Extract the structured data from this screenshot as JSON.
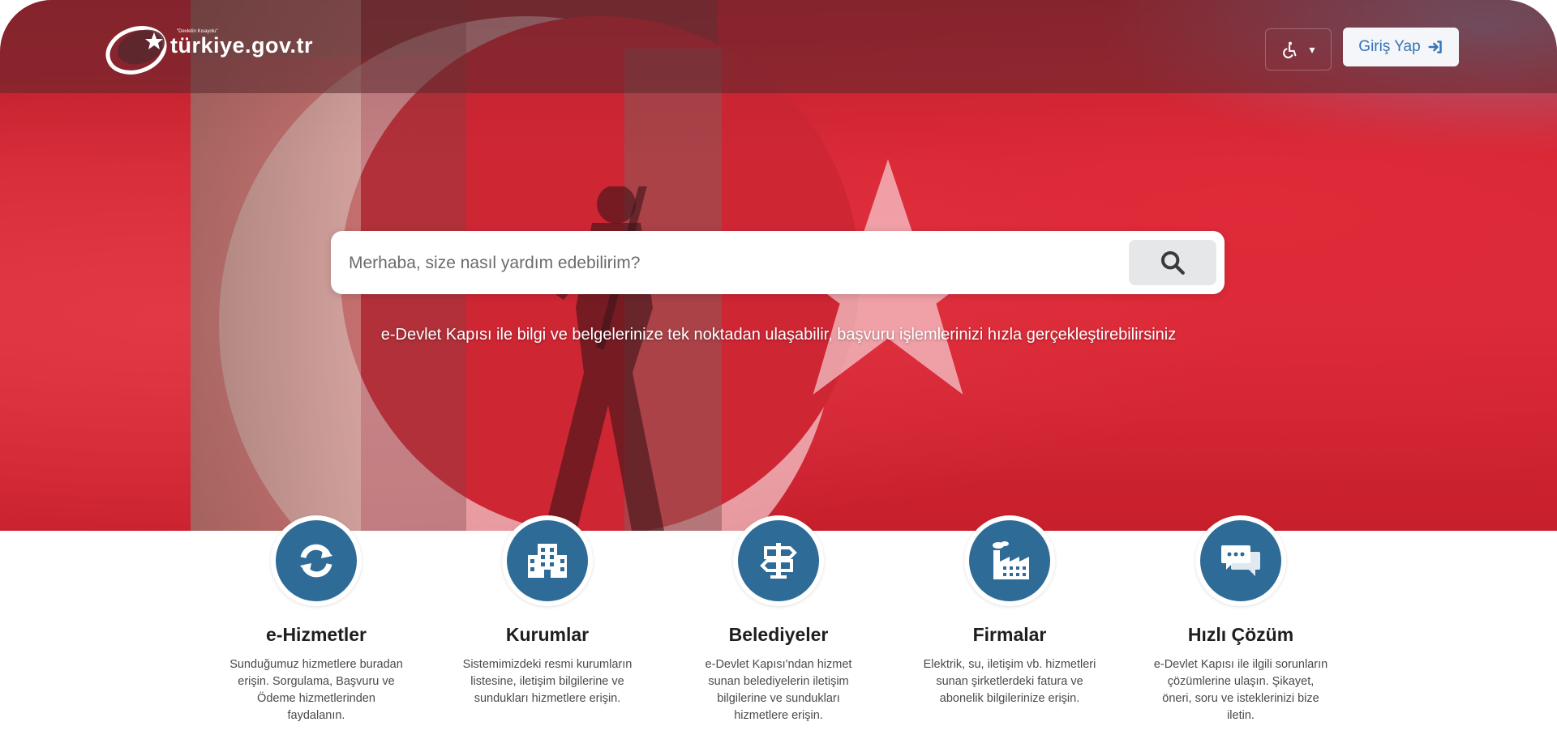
{
  "header": {
    "logo_text": "türkiye.gov.tr",
    "logo_sub": "\"Devletin Kısayolu\"",
    "accessibility_caret": "▾",
    "login_label": "Giriş Yap"
  },
  "search": {
    "placeholder": "Merhaba, size nasıl yardım edebilirim?"
  },
  "tagline": "e-Devlet Kapısı ile bilgi ve belgelerinize tek noktadan ulaşabilir, başvuru işlemlerinizi hızla gerçekleştirebilirsiniz",
  "cards": [
    {
      "title": "e-Hizmetler",
      "desc": "Sunduğumuz hizmetlere buradan erişin. Sorgulama, Başvuru ve Ödeme hizmetlerinden faydalanın.",
      "icon": "refresh-icon"
    },
    {
      "title": "Kurumlar",
      "desc": "Sistemimizdeki resmi kurumların listesine, iletişim bilgilerine ve sundukları hizmetlere erişin.",
      "icon": "building-icon"
    },
    {
      "title": "Belediyeler",
      "desc": "e-Devlet Kapısı'ndan hizmet sunan belediyelerin iletişim bilgilerine ve sundukları hizmetlere erişin.",
      "icon": "signpost-icon"
    },
    {
      "title": "Firmalar",
      "desc": "Elektrik, su, iletişim vb. hizmetleri sunan şirketlerdeki fatura ve abonelik bilgilerinize erişin.",
      "icon": "factory-icon"
    },
    {
      "title": "Hızlı Çözüm",
      "desc": "e-Devlet Kapısı ile ilgili sorunların çözümlerine ulaşın. Şikayet, öneri, soru ve isteklerinizi bize iletin.",
      "icon": "chat-icon"
    }
  ],
  "colors": {
    "brand_blue": "#2e6b97",
    "flag_red": "#d82a37",
    "login_text": "#3473b8"
  }
}
